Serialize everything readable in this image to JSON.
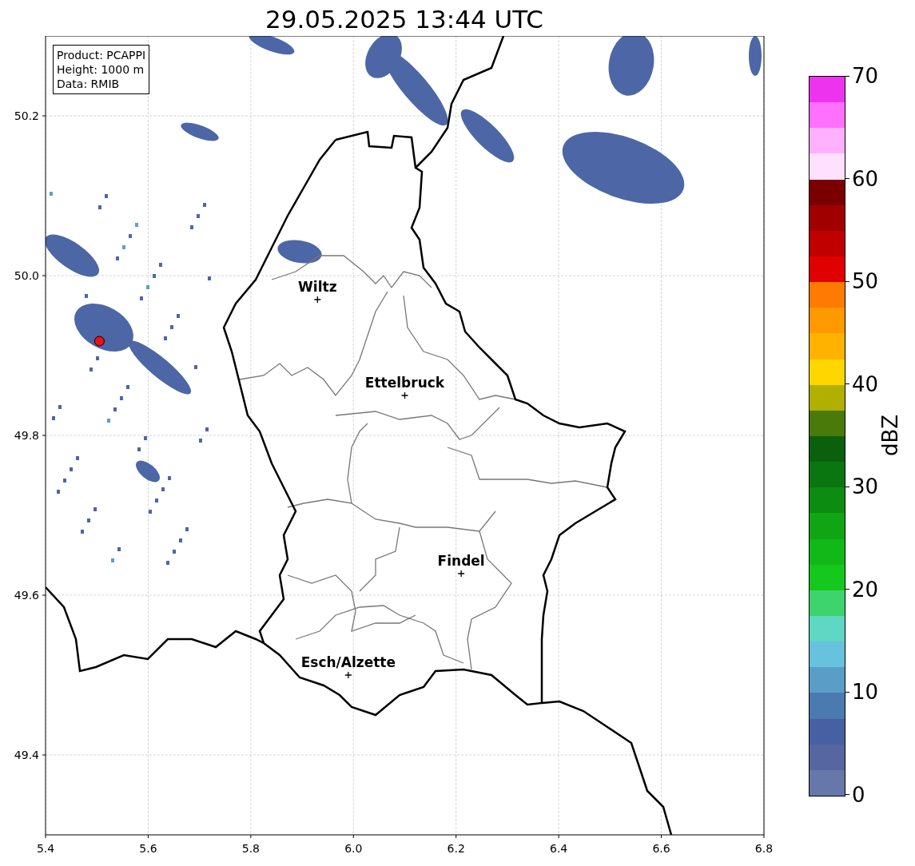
{
  "title": "29.05.2025 13:44 UTC",
  "info_box": [
    "Product: PCAPPI",
    "Height: 1000 m",
    "Data: RMIB"
  ],
  "map": {
    "x_ticks": [
      "5.4",
      "5.6",
      "5.8",
      "6.0",
      "6.2",
      "6.4",
      "6.6",
      "6.8"
    ],
    "y_ticks": [
      "50.2",
      "50.0",
      "49.8",
      "49.6",
      "49.4"
    ],
    "cities": [
      {
        "name": "Wiltz"
      },
      {
        "name": "Ettelbruck"
      },
      {
        "name": "Findel"
      },
      {
        "name": "Esch/Alzette"
      }
    ]
  },
  "colorbar": {
    "label": "dBZ",
    "ticks": [
      "70",
      "60",
      "50",
      "40",
      "30",
      "20",
      "10",
      "0"
    ],
    "bands": [
      {
        "color": "#ee33ee"
      },
      {
        "color": "#ff70ff"
      },
      {
        "color": "#ffb0ff"
      },
      {
        "color": "#ffe0ff"
      },
      {
        "color": "#7a0000"
      },
      {
        "color": "#a00000"
      },
      {
        "color": "#c00000"
      },
      {
        "color": "#e00000"
      },
      {
        "color": "#ff7a00"
      },
      {
        "color": "#ff9900"
      },
      {
        "color": "#ffb300"
      },
      {
        "color": "#ffd600"
      },
      {
        "color": "#b0b000"
      },
      {
        "color": "#4a7a0a"
      },
      {
        "color": "#0a600c"
      },
      {
        "color": "#0a7610"
      },
      {
        "color": "#0c8c10"
      },
      {
        "color": "#0fa514"
      },
      {
        "color": "#10b818"
      },
      {
        "color": "#14c81e"
      },
      {
        "color": "#3dd46e"
      },
      {
        "color": "#60d6c4"
      },
      {
        "color": "#66c2dd"
      },
      {
        "color": "#5a9ec8"
      },
      {
        "color": "#4a7ab0"
      },
      {
        "color": "#4660a3"
      },
      {
        "color": "#5566a0"
      },
      {
        "color": "#6677aa"
      }
    ]
  }
}
